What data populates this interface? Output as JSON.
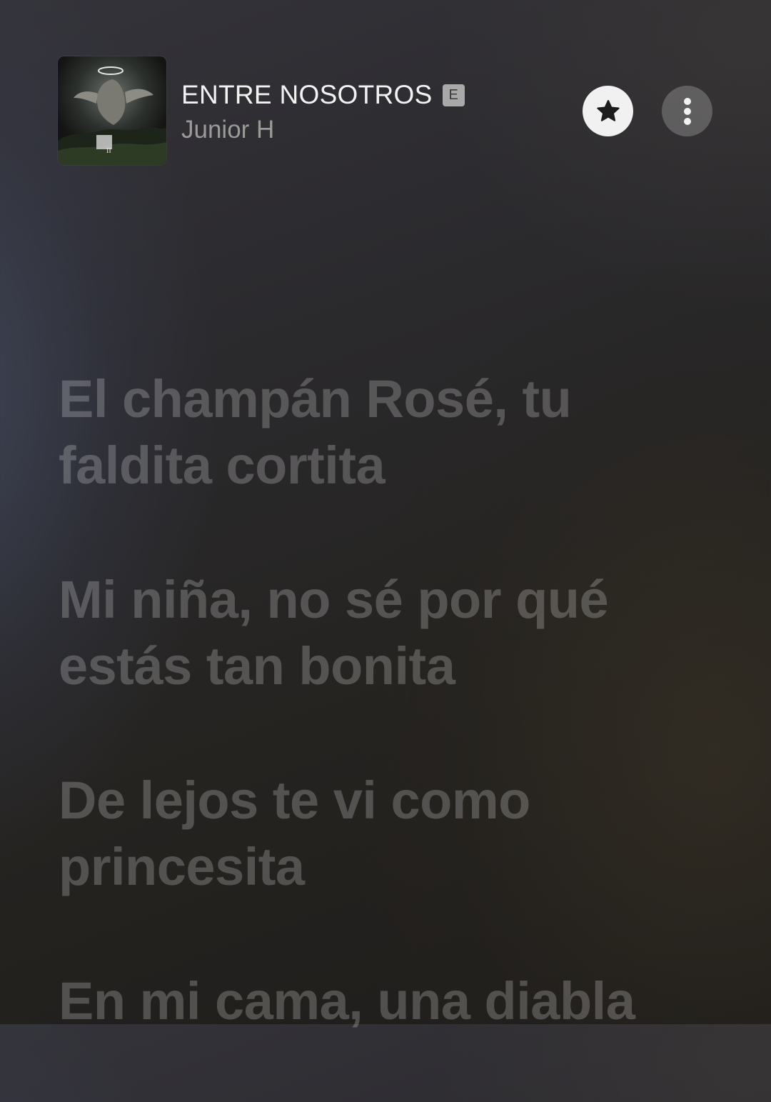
{
  "now_playing": {
    "title": "ENTRE NOSOTROS",
    "explicit_label": "E",
    "artist": "Junior H",
    "artwork_label": "II"
  },
  "actions": {
    "favorite_icon": "star-icon",
    "more_icon": "ellipsis-vertical-icon"
  },
  "lyrics": {
    "lines": [
      "El champán Rosé, tu faldita cortita",
      "Mi niña, no sé por qué estás tan bonita",
      "De lejos te vi como princesita",
      "En mi cama, una diabla"
    ]
  },
  "colors": {
    "lyric_inactive": "rgba(255,255,255,0.22)",
    "artist_text": "#9b9a98",
    "favorite_button_bg": "#f1f1f1"
  }
}
